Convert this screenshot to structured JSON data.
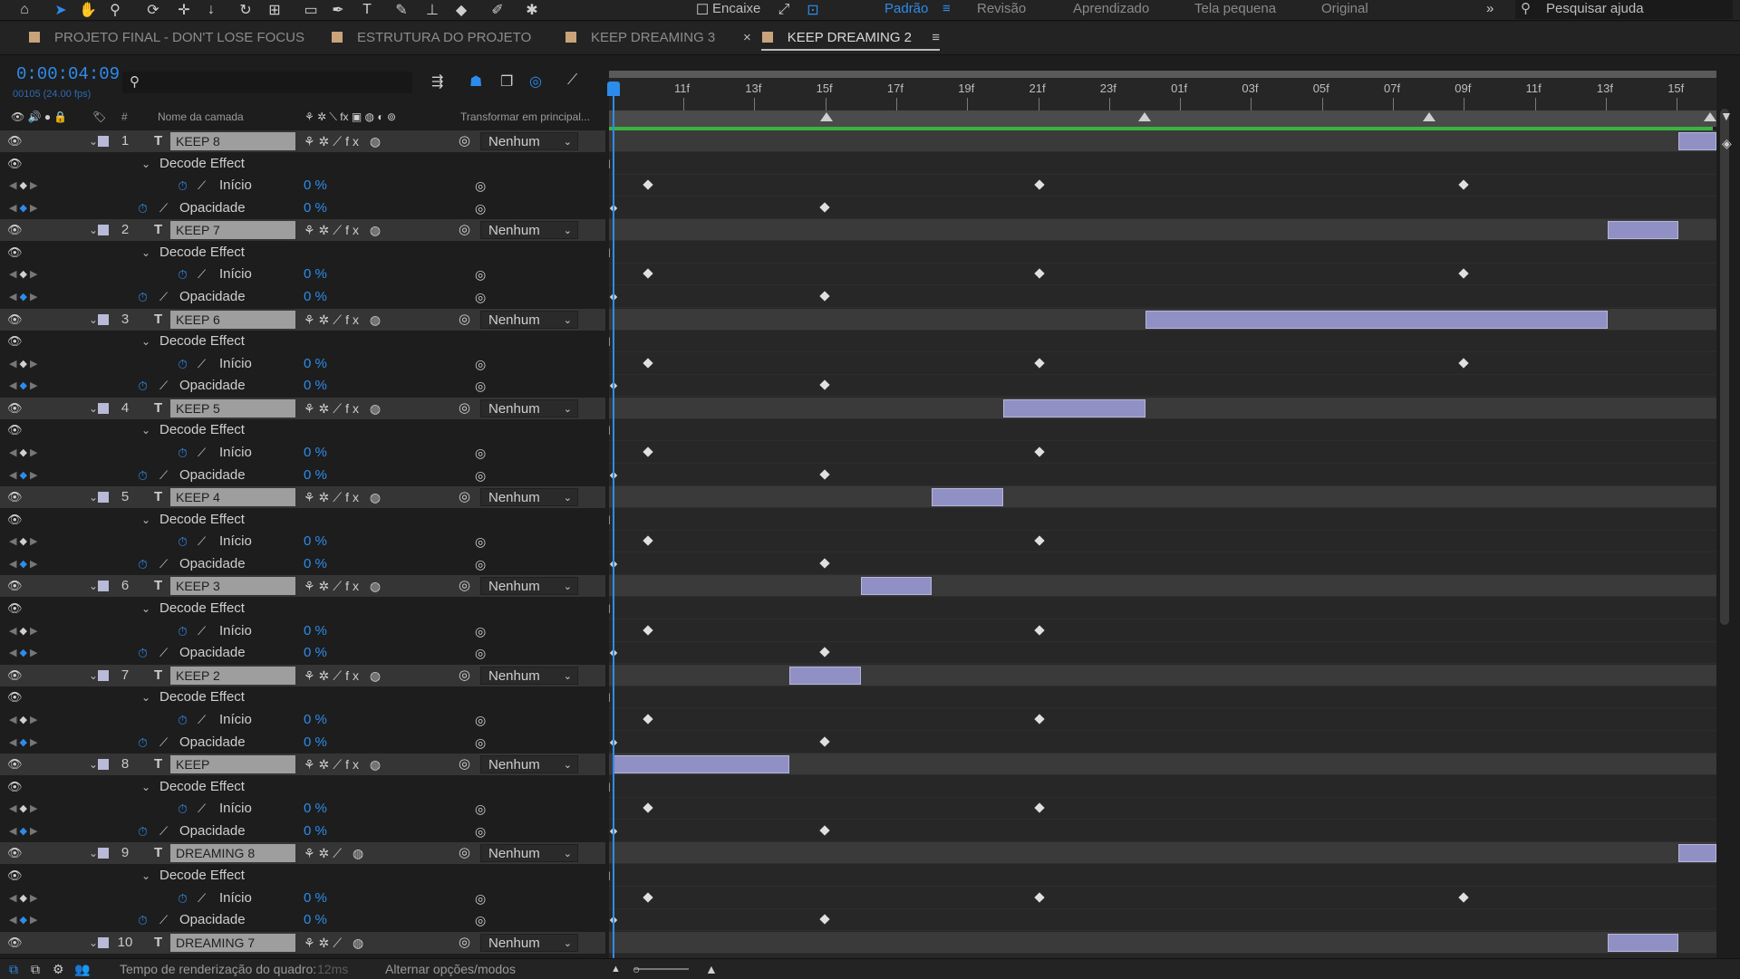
{
  "toolbar": {
    "snap_label": "Encaixe",
    "workspaces": [
      "Padrão",
      "Revisão",
      "Aprendizado",
      "Tela pequena",
      "Original"
    ],
    "active_workspace": "Padrão",
    "search_placeholder": "Pesquisar ajuda"
  },
  "tabs": [
    {
      "label": "PROJETO FINAL - DON'T LOSE FOCUS",
      "active": false
    },
    {
      "label": "ESTRUTURA DO PROJETO",
      "active": false
    },
    {
      "label": "KEEP DREAMING 3",
      "active": false
    },
    {
      "label": "KEEP DREAMING 2",
      "active": true
    }
  ],
  "timeline": {
    "timecode": "0:00:04:09",
    "fps": "00105 (24.00 fps)",
    "columns": {
      "layer_name": "Nome da camada",
      "hash": "#",
      "parent": "Transformar em principal..."
    },
    "ruler_ticks": [
      "11f",
      "13f",
      "15f",
      "17f",
      "19f",
      "21f",
      "23f",
      "01f",
      "03f",
      "05f",
      "07f",
      "09f",
      "11f",
      "13f",
      "15f"
    ],
    "group_label": "Decode Effect",
    "prop_start": "Início",
    "prop_opacity": "Opacidade",
    "prop_value": "0 %",
    "parent_value": "Nenhum",
    "layers": [
      {
        "num": "1",
        "name": "KEEP 8",
        "has_fx": true,
        "bar_start": 0.9656,
        "bar_end": 1.0,
        "kf_start": [
          0.0322,
          0.3866,
          0.7709
        ],
        "kf_opacity": [
          0.0,
          0.1922
        ]
      },
      {
        "num": "2",
        "name": "KEEP 7",
        "has_fx": true,
        "bar_start": 0.9013,
        "bar_end": 0.9656,
        "kf_start": [
          0.0322,
          0.3866,
          0.7709
        ],
        "kf_opacity": [
          0.0,
          0.1922
        ]
      },
      {
        "num": "3",
        "name": "KEEP 6",
        "has_fx": true,
        "bar_start": 0.4826,
        "bar_end": 0.9013,
        "kf_start": [
          0.0322,
          0.3866,
          0.7709
        ],
        "kf_opacity": [
          0.0,
          0.1922
        ]
      },
      {
        "num": "4",
        "name": "KEEP 5",
        "has_fx": true,
        "bar_start": 0.3542,
        "bar_end": 0.4826,
        "kf_start": [
          0.0322,
          0.3866
        ],
        "kf_opacity": [
          0.0,
          0.1922
        ]
      },
      {
        "num": "5",
        "name": "KEEP 4",
        "has_fx": true,
        "bar_start": 0.2894,
        "bar_end": 0.3542,
        "kf_start": [
          0.0322,
          0.3866
        ],
        "kf_opacity": [
          0.0,
          0.1922
        ]
      },
      {
        "num": "6",
        "name": "KEEP 3",
        "has_fx": true,
        "bar_start": 0.2251,
        "bar_end": 0.2894,
        "kf_start": [
          0.0322,
          0.3866
        ],
        "kf_opacity": [
          0.0,
          0.1922
        ]
      },
      {
        "num": "7",
        "name": "KEEP 2",
        "has_fx": true,
        "bar_start": 0.1605,
        "bar_end": 0.2251,
        "kf_start": [
          0.0322,
          0.3866
        ],
        "kf_opacity": [
          0.0,
          0.1922
        ]
      },
      {
        "num": "8",
        "name": "KEEP",
        "has_fx": true,
        "bar_start": 0.0,
        "bar_end": 0.1605,
        "kf_start": [
          0.0322,
          0.3866
        ],
        "kf_opacity": [
          0.0,
          0.1922
        ]
      },
      {
        "num": "9",
        "name": "DREAMING 8",
        "has_fx": false,
        "bar_start": 0.9656,
        "bar_end": 1.0,
        "kf_start": [
          0.0322,
          0.3866,
          0.7709
        ],
        "kf_opacity": [
          0.0,
          0.1922
        ]
      },
      {
        "num": "10",
        "name": "DREAMING 7",
        "has_fx": false,
        "bar_start": 0.9013,
        "bar_end": 0.9656,
        "kf_start": [],
        "kf_opacity": []
      }
    ]
  },
  "statusbar": {
    "render_label": "Tempo de renderização do quadro:",
    "render_value": "12ms",
    "toggle_label": "Alternar opções/modos"
  }
}
